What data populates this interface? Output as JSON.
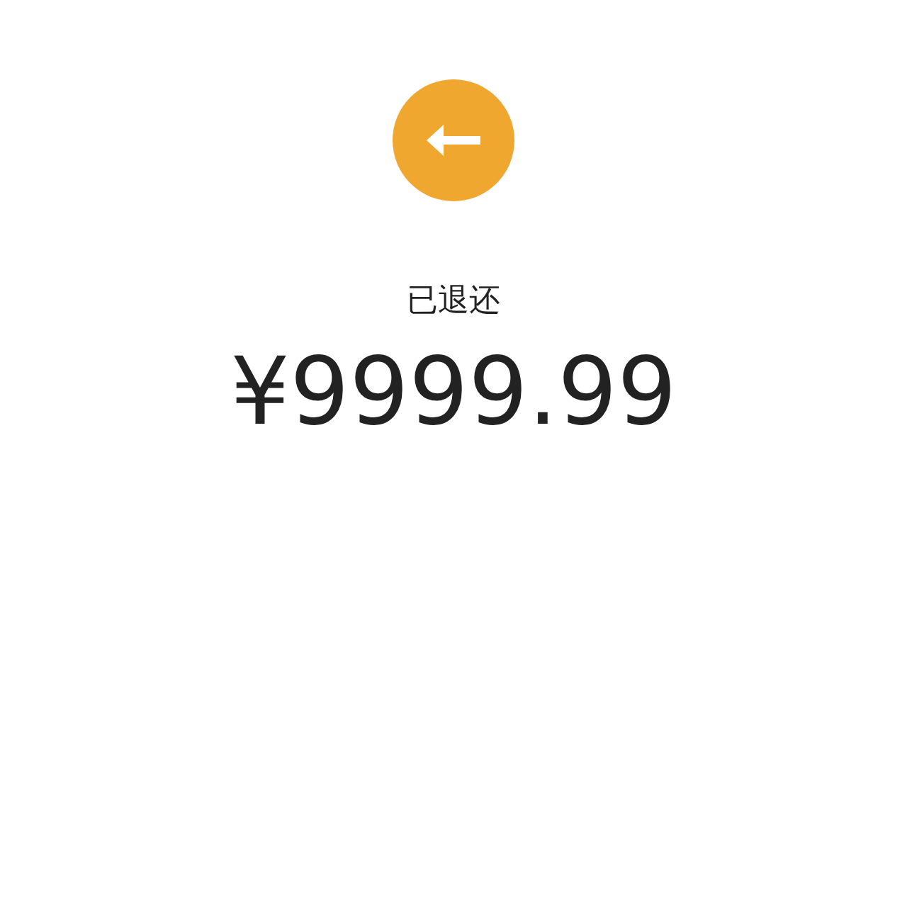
{
  "status": {
    "label": "已退还",
    "amount": "¥9999.99"
  }
}
